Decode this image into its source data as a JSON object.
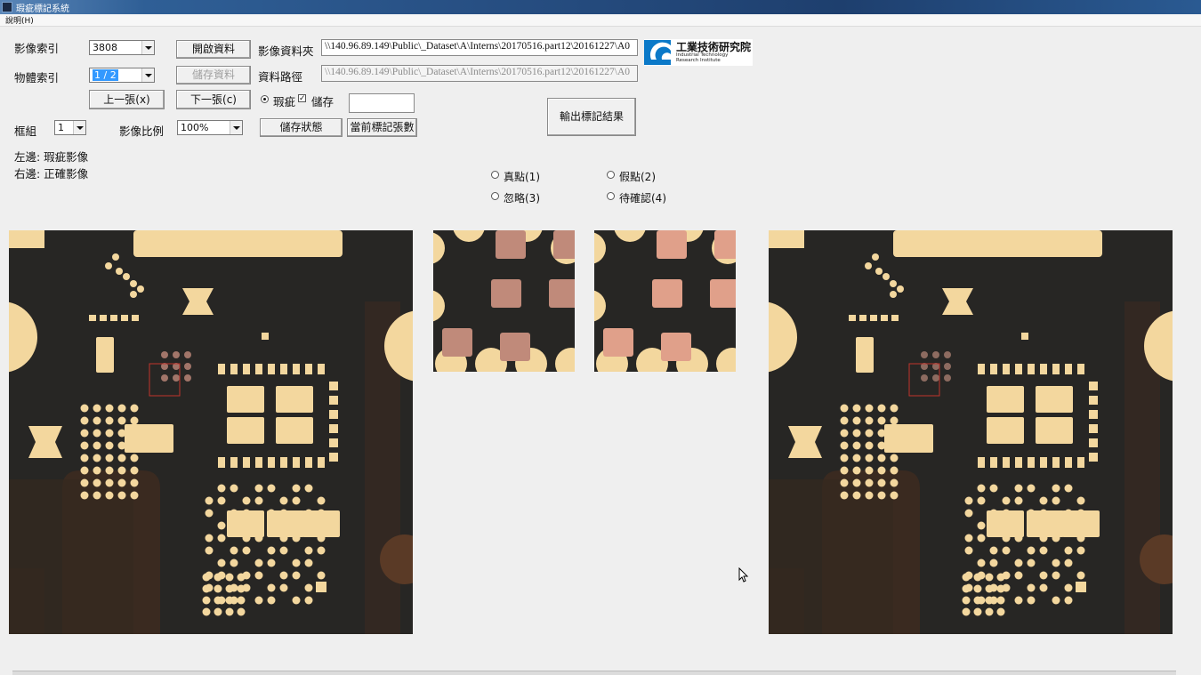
{
  "window": {
    "title": "瑕疵標記系統",
    "menu_help": "說明(H)"
  },
  "form": {
    "image_index_label": "影像索引",
    "image_index_value": "3808",
    "object_index_label": "物體索引",
    "object_index_value": "1 / 2",
    "open_button": "開啟資料",
    "save_data_button": "儲存資料",
    "prev_button": "上一張(x)",
    "next_button": "下一張(c)",
    "image_folder_label": "影像資料夾",
    "image_folder_value": "\\\\140.96.89.149\\Public\\_Dataset\\A\\Interns\\20170516.part12\\20161227\\A0",
    "data_path_label": "資料路徑",
    "data_path_value": "\\\\140.96.89.149\\Public\\_Dataset\\A\\Interns\\20170516.part12\\20161227\\A0",
    "defect_radio_label": "瑕疵",
    "save_checkbox_label": "儲存",
    "frame_group_label": "框組",
    "frame_group_value": "1",
    "scale_label": "影像比例",
    "scale_value": "100%",
    "save_state_button": "儲存狀態",
    "current_count_button": "當前標記張數",
    "export_button": "輸出標記結果",
    "left_note": "左邊: 瑕疵影像",
    "right_note": "右邊: 正確影像"
  },
  "classification": {
    "true_point": "真點(1)",
    "false_point": "假點(2)",
    "ignore": "忽略(3)",
    "pending": "待確認(4)"
  },
  "logo": {
    "name": "工業技術研究院",
    "sub1": "Industrial Technology",
    "sub2": "Research Institute",
    "color": "#0b79c8"
  },
  "colors": {
    "board": "#272624",
    "pad": "#f3d79e",
    "copper": "#5a3a26",
    "defect_pad": "#c08a7a",
    "selection_box": "#c0342c"
  }
}
